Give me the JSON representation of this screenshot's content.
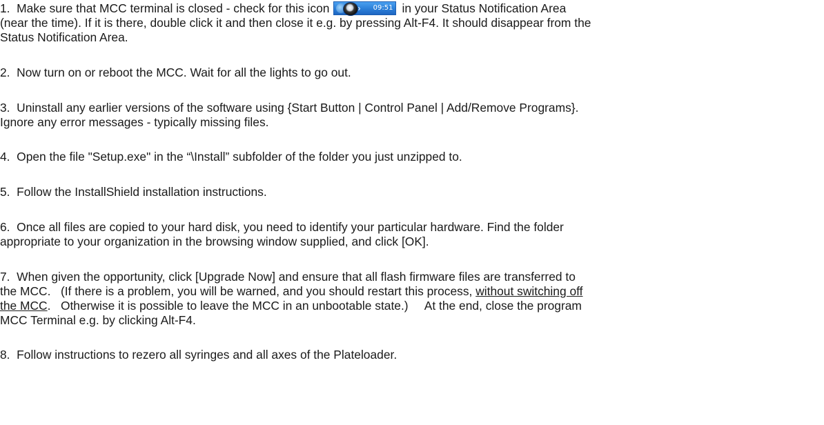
{
  "tray_icon": {
    "time": "09:51",
    "colors": {
      "taskbar": "#2c7fd8",
      "text": "#ffffff"
    }
  },
  "steps": [
    {
      "line1_before_icon": "1.  Make sure that MCC terminal is closed - check for this icon",
      "line1_after_icon": "in your Status Notification Area",
      "line2": "(near the time). If it is there, double click it and then close it e.g. by pressing Alt-F4. It should disappear from the",
      "line3": "Status Notification Area."
    },
    {
      "line1": "2.  Now turn on or reboot the MCC. Wait for all the lights to go out."
    },
    {
      "line1": "3.  Uninstall any earlier versions of the software using {Start Button | Control Panel | Add/Remove Programs}.",
      "line2": "Ignore any error messages - typically missing files."
    },
    {
      "line1": "4.  Open the file \"Setup.exe\" in the “\\Install” subfolder of the folder you just unzipped to."
    },
    {
      "line1": "5.  Follow the InstallShield installation instructions."
    },
    {
      "line1": "6.  Once all files are copied to your hard disk, you need to identify your particular hardware. Find the folder",
      "line2": "appropriate to your organization in the browsing window supplied, and click [OK]."
    },
    {
      "line1": "7.  When given the opportunity, click [Upgrade Now] and ensure that all flash firmware files are transferred to",
      "line2_before": "the MCC.   (If there is a problem, you will be warned, and you should restart this process, ",
      "line2_underlined": "without switching off",
      "line3_underlined": "the MCC",
      "line3_after": ".   Otherwise it is possible to leave the MCC in an unbootable state.)     At the end, close the program",
      "line4": "MCC Terminal e.g. by clicking Alt-F4."
    },
    {
      "line1": "8.  Follow instructions to rezero all syringes and all axes of the Plateloader."
    }
  ]
}
